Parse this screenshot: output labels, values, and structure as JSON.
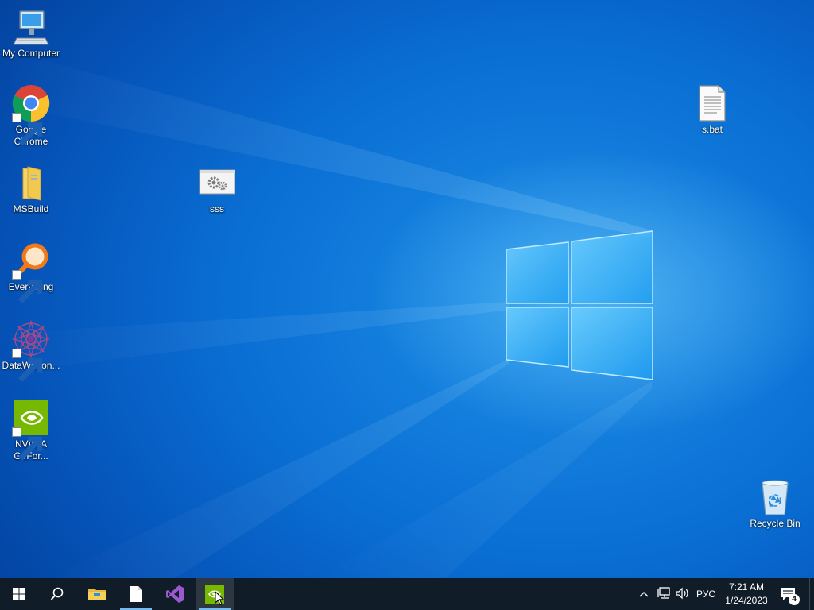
{
  "desktop": {
    "icons": [
      {
        "label": "My Computer",
        "icon": "computer-icon"
      },
      {
        "label": "Google Chrome",
        "icon": "chrome-icon",
        "shortcut": true
      },
      {
        "label": "MSBuild",
        "icon": "folder-icon"
      },
      {
        "label": "Everything",
        "icon": "everything-search-icon",
        "shortcut": true
      },
      {
        "label": "DataWagon...",
        "icon": "datawagon-icon",
        "shortcut": true
      },
      {
        "label": "NVIDIA GeFor...",
        "icon": "nvidia-icon",
        "shortcut": true
      },
      {
        "label": "sss",
        "icon": "settings-window-icon"
      },
      {
        "label": "s.bat",
        "icon": "text-file-icon"
      },
      {
        "label": "Recycle Bin",
        "icon": "recycle-bin-icon"
      }
    ]
  },
  "taskbar": {
    "buttons": [
      {
        "name": "start",
        "icon": "windows-logo-icon"
      },
      {
        "name": "search",
        "icon": "search-icon"
      },
      {
        "name": "file-explorer",
        "icon": "folder-icon"
      },
      {
        "name": "notepad",
        "icon": "document-icon"
      },
      {
        "name": "visual-studio",
        "icon": "visual-studio-icon"
      },
      {
        "name": "nvidia-geforce",
        "icon": "nvidia-icon"
      }
    ],
    "tray": {
      "language": "РУС",
      "time": "7:21 AM",
      "date": "1/24/2023",
      "notification_count": "4"
    }
  },
  "colors": {
    "desktop_blue": "#0a6fd4",
    "taskbar": "#101c28",
    "accent_underline": "#76b9ed",
    "nvidia_green": "#76b900"
  }
}
